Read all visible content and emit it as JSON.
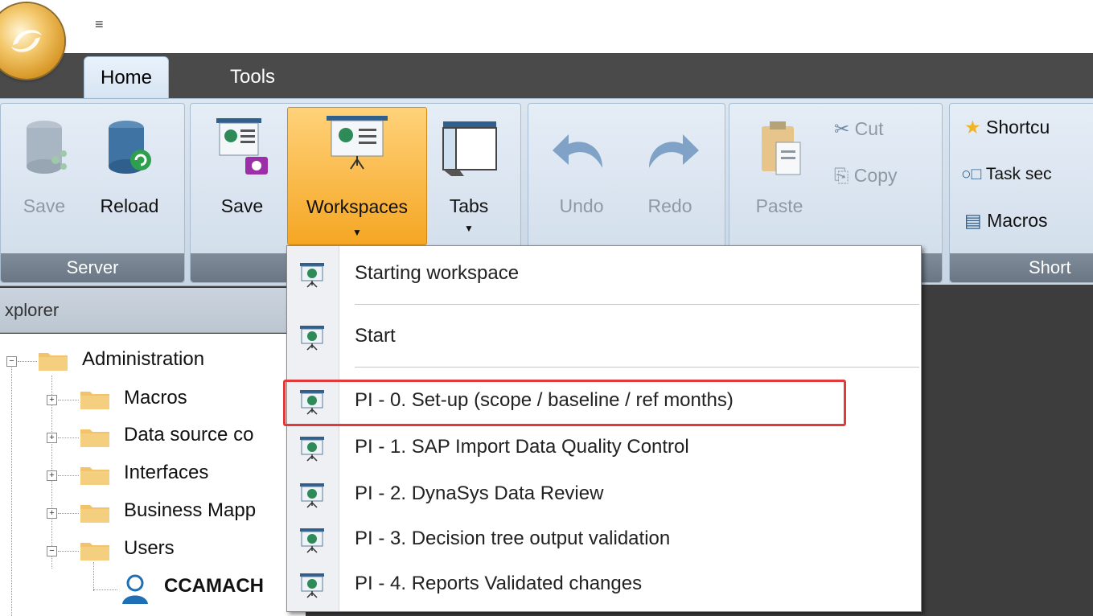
{
  "qat": {
    "arrow": "≡"
  },
  "tabs": [
    {
      "label": "Home"
    },
    {
      "label": "Tools"
    }
  ],
  "ribbon": {
    "server": {
      "label": "Server",
      "save": "Save",
      "reload": "Reload"
    },
    "workspace": {
      "save": "Save",
      "workspaces": "Workspaces",
      "tabs": "Tabs"
    },
    "edit": {
      "undo": "Undo",
      "redo": "Redo"
    },
    "clipboard": {
      "paste": "Paste",
      "cut": "Cut",
      "copy": "Copy"
    },
    "shortcuts": {
      "shortcut": "Shortcu",
      "task": "Task sec",
      "macros": "Macros",
      "label": "Short"
    }
  },
  "explorer": {
    "title": "xplorer",
    "items": [
      {
        "label": "Administration"
      },
      {
        "label": "Macros"
      },
      {
        "label": "Data source co"
      },
      {
        "label": "Interfaces"
      },
      {
        "label": "Business Mapp"
      },
      {
        "label": "Users"
      },
      {
        "label": "CCAMACH"
      }
    ]
  },
  "menu": {
    "items": [
      {
        "label": "Starting workspace"
      },
      {
        "label": "Start"
      },
      {
        "label": "PI - 0. Set-up (scope / baseline / ref months)"
      },
      {
        "label": "PI - 1. SAP Import Data Quality Control"
      },
      {
        "label": "PI - 2. DynaSys Data Review"
      },
      {
        "label": "PI - 3. Decision tree output validation"
      },
      {
        "label": "PI - 4. Reports  Validated changes"
      }
    ]
  },
  "colors": {
    "highlight": "#f5a623",
    "annotation": "#e23a3a",
    "icon_green": "#2e8b57"
  }
}
